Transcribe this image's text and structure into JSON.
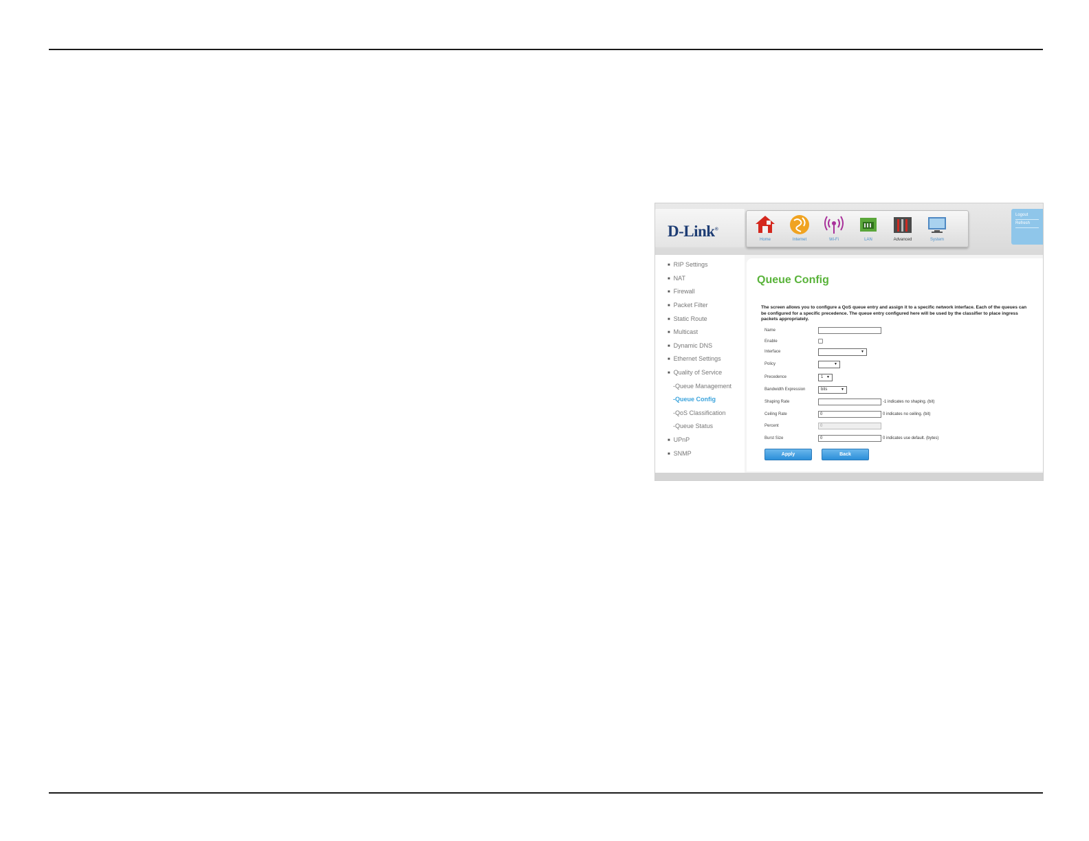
{
  "brand": {
    "logo": "D-Link",
    "reg": "®"
  },
  "nav": [
    {
      "label": "Home",
      "icon": "home-icon"
    },
    {
      "label": "Internet",
      "icon": "globe-icon"
    },
    {
      "label": "Wi-Fi",
      "icon": "wifi-icon"
    },
    {
      "label": "LAN",
      "icon": "lan-icon"
    },
    {
      "label": "Advanced",
      "icon": "tools-icon"
    },
    {
      "label": "System",
      "icon": "monitor-icon"
    }
  ],
  "account": {
    "logout": "Logout",
    "refresh": "Refresh"
  },
  "sidebar": {
    "items": [
      "RIP Settings",
      "NAT",
      "Firewall",
      "Packet Filter",
      "Static Route",
      "Multicast",
      "Dynamic DNS",
      "Ethernet Settings",
      "Quality of Service"
    ],
    "sub": [
      "-Queue Management",
      "-Queue Config",
      "-QoS Classification",
      "-Queue Status"
    ],
    "after": [
      "UPnP",
      "SNMP"
    ]
  },
  "page": {
    "title": "Queue Config",
    "description": "The screen allows you to configure a QoS queue entry and assign it to a specific network interface. Each of the queues can be configured for a specific precedence. The queue entry configured here will be used by the classifier to place ingress packets appropriately."
  },
  "form": {
    "name_label": "Name",
    "enable_label": "Enable",
    "interface_label": "Interface",
    "policy_label": "Policy",
    "precedence_label": "Precedence",
    "precedence_value": "1",
    "bandwidth_label": "Bandwidth Expression",
    "bandwidth_value": "bits",
    "shaping_label": "Shaping Rate",
    "shaping_hint": "-1 indicates no shaping. (bit)",
    "ceiling_label": "Ceiling Rate",
    "ceiling_value": "0",
    "ceiling_hint": "0 indicates no ceiling. (bit)",
    "percent_label": "Percent",
    "percent_value": "0",
    "burst_label": "Burst Size",
    "burst_value": "0",
    "burst_hint": "0 indicates use default. (bytes)",
    "apply_label": "Apply",
    "back_label": "Back"
  },
  "colors": {
    "title_green": "#59b33a",
    "link_blue": "#3aa3dc",
    "button_blue": "#2c8fd9"
  }
}
